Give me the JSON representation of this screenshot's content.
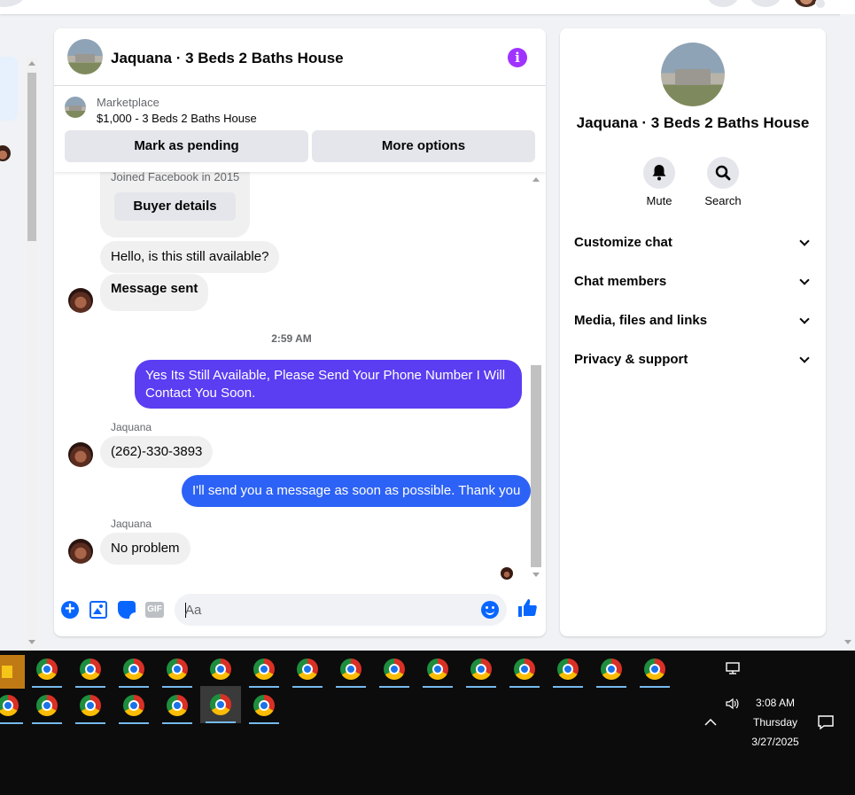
{
  "conversation": {
    "title": "Jaquana · 3 Beds 2 Baths House",
    "listing": {
      "label": "Marketplace",
      "price_title": "$1,000 - 3 Beds 2 Baths House",
      "mark_pending_label": "Mark as pending",
      "more_options_label": "More options"
    },
    "buyer_card": {
      "joined": "Joined Facebook in 2015",
      "buyer_details_label": "Buyer details"
    },
    "messages": [
      {
        "direction": "in",
        "text": "Hello, is this still available?"
      },
      {
        "direction": "in",
        "text": "Message sent"
      },
      {
        "direction": "timestamp",
        "text": "2:59 AM"
      },
      {
        "direction": "out",
        "text": "Yes Its Still Available, Please Send Your Phone Number I Will Contact You Soon."
      },
      {
        "direction": "in",
        "sender": "Jaquana",
        "text": "(262)-330-3893"
      },
      {
        "direction": "out",
        "text": "I'll send you a message as soon as possible. Thank you"
      },
      {
        "direction": "in",
        "sender": "Jaquana",
        "text": "No problem"
      }
    ],
    "composer": {
      "placeholder": "Aa",
      "gif_label": "GIF"
    }
  },
  "info_panel": {
    "name": "Jaquana · 3 Beds 2 Baths House",
    "actions": [
      {
        "label": "Mute",
        "icon": "bell-icon"
      },
      {
        "label": "Search",
        "icon": "search-icon"
      }
    ],
    "sections": [
      {
        "label": "Customize chat"
      },
      {
        "label": "Chat members"
      },
      {
        "label": "Media, files and links"
      },
      {
        "label": "Privacy & support"
      }
    ]
  },
  "taskbar": {
    "time": "3:08 AM",
    "day": "Thursday",
    "date": "3/27/2025",
    "icons": [
      "network-icon",
      "volume-icon",
      "chevron-up-icon",
      "notification-icon"
    ]
  },
  "colors": {
    "accent_purple": "#5b3df2",
    "accent_blue": "#2d62f6",
    "messenger_blue": "#0866ff",
    "info_purple": "#a033ff"
  }
}
